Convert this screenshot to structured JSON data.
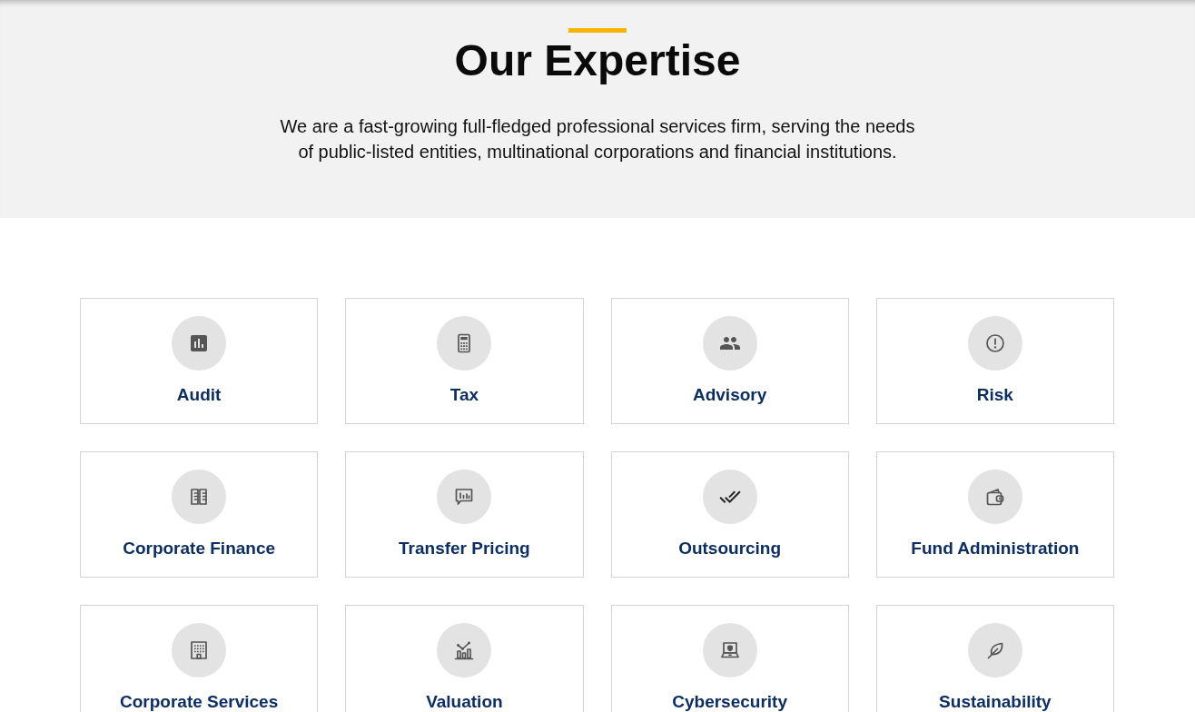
{
  "header": {
    "title": "Our Expertise",
    "intro": "We are a fast-growing full-fledged professional services firm, serving the needs of public-listed entities, multinational corporations and financial institutions."
  },
  "services": [
    {
      "label": "Audit"
    },
    {
      "label": "Tax"
    },
    {
      "label": "Advisory"
    },
    {
      "label": "Risk"
    },
    {
      "label": "Corporate Finance"
    },
    {
      "label": "Transfer Pricing"
    },
    {
      "label": "Outsourcing"
    },
    {
      "label": "Fund Administration"
    },
    {
      "label": "Corporate Services"
    },
    {
      "label": "Valuation"
    },
    {
      "label": "Cybersecurity"
    },
    {
      "label": "Sustainability"
    }
  ]
}
